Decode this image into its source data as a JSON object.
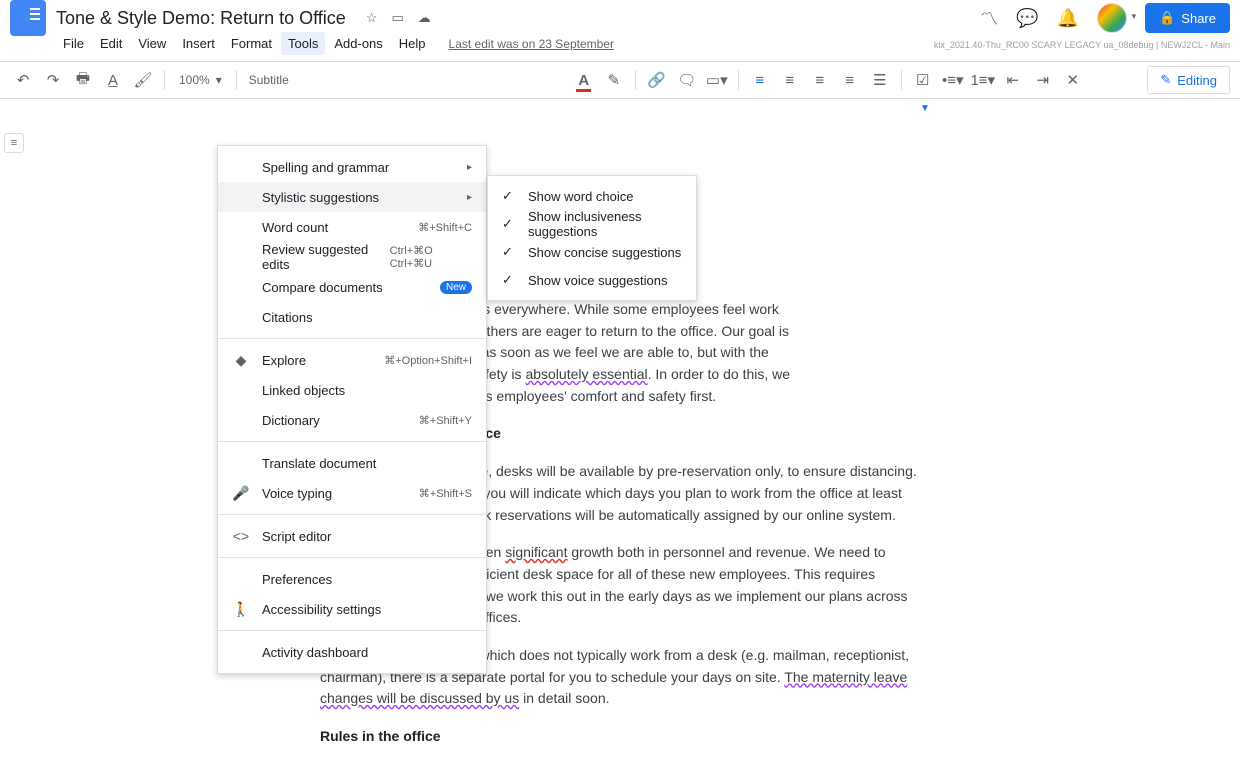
{
  "title": "Tone & Style Demo: Return to Office",
  "menubar": [
    "File",
    "Edit",
    "View",
    "Insert",
    "Format",
    "Tools",
    "Add-ons",
    "Help"
  ],
  "last_edit": "Last edit was on 23 September",
  "share": "Share",
  "metaline": "kix_2021.40-Thu_RC00 SCARY LEGACY ua_08debug | NEWJ2CL - Main",
  "toolbar": {
    "zoom": "100%",
    "style": "Subtitle",
    "editing": "Editing"
  },
  "tools_menu": {
    "spelling": "Spelling and grammar",
    "stylistic": "Stylistic suggestions",
    "wordcount": "Word count",
    "wordcount_sc": "⌘+Shift+C",
    "review": "Review suggested edits",
    "review_sc": "Ctrl+⌘O Ctrl+⌘U",
    "compare": "Compare documents",
    "new_badge": "New",
    "citations": "Citations",
    "explore": "Explore",
    "explore_sc": "⌘+Option+Shift+I",
    "linked": "Linked objects",
    "dictionary": "Dictionary",
    "dictionary_sc": "⌘+Shift+Y",
    "translate": "Translate document",
    "voice": "Voice typing",
    "voice_sc": "⌘+Shift+S",
    "script": "Script editor",
    "prefs": "Preferences",
    "a11y": "Accessibility settings",
    "activity": "Activity dashboard"
  },
  "submenu": {
    "word_choice": "Show word choice",
    "inclusive": "Show inclusiveness suggestions",
    "concise": "Show concise suggestions",
    "voice": "Show voice suggestions"
  },
  "doc": {
    "p1a": "been difficult for employees everywhere. While some employees feel work ",
    "p1b": "en a positive experience, others are eager to return to the office. Our goal is ",
    "p1c": "ployees back to the office as soon as we feel we are able to, but with the ",
    "p1d": "t employee comfort and safety is ",
    "p1e": "absolutely essential",
    "p1f": ". In order to do this, we ",
    "p1g": "eturn to office plan that puts employees' comfort and safety first.",
    "h1": " in the Office",
    "p2": "o the office, desks will be available by pre-reservation only, to ensure distancing. Through the online portal, you will indicate which days you plan to work from the office at least one week in advance.  Desk reservations will be automatically assigned by our online system.",
    "p3a": "This past year, we have seen ",
    "p3b": "significant",
    "p3c": " growth both in personnel and revenue. We need to make sure we can find sufficient desk space for all of these new employees. This requires everyone being flexible as we work this out in the early days as we implement our plans across all of the North American offices.",
    "p4a": "If you have a job function which does not typically work from a desk (e.g. mailman, receptionist, chairman), there is a separate portal for you to schedule your days on site. ",
    "p4b": "The maternity leave changes will be discussed by us",
    "p4c": " in detail soon.",
    "h2": "Rules in the office"
  }
}
